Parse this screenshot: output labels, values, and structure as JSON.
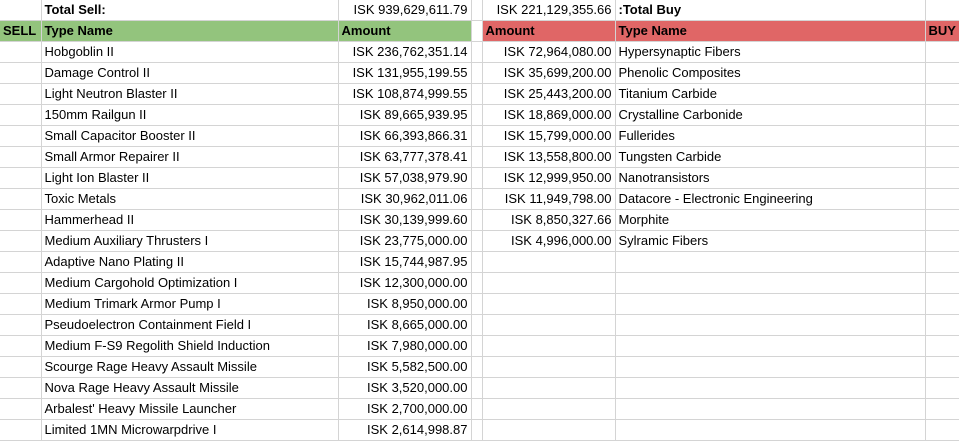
{
  "summary": {
    "total_sell_label": "Total Sell:",
    "total_sell_value": "ISK 939,629,611.79",
    "total_buy_value": "ISK 221,129,355.66",
    "total_buy_label": ":Total Buy"
  },
  "sell": {
    "tag": "SELL",
    "header_type": "Type Name",
    "header_amount": "Amount",
    "rows": [
      {
        "name": "Hobgoblin II",
        "amount": "ISK 236,762,351.14"
      },
      {
        "name": "Damage Control II",
        "amount": "ISK 131,955,199.55"
      },
      {
        "name": "Light Neutron Blaster II",
        "amount": "ISK 108,874,999.55"
      },
      {
        "name": "150mm Railgun II",
        "amount": "ISK 89,665,939.95"
      },
      {
        "name": "Small Capacitor Booster II",
        "amount": "ISK 66,393,866.31"
      },
      {
        "name": "Small Armor Repairer II",
        "amount": "ISK 63,777,378.41"
      },
      {
        "name": "Light Ion Blaster II",
        "amount": "ISK 57,038,979.90"
      },
      {
        "name": "Toxic Metals",
        "amount": "ISK 30,962,011.06"
      },
      {
        "name": "Hammerhead II",
        "amount": "ISK 30,139,999.60"
      },
      {
        "name": "Medium Auxiliary Thrusters I",
        "amount": "ISK 23,775,000.00"
      },
      {
        "name": "Adaptive Nano Plating II",
        "amount": "ISK 15,744,987.95"
      },
      {
        "name": "Medium Cargohold Optimization I",
        "amount": "ISK 12,300,000.00"
      },
      {
        "name": "Medium Trimark Armor Pump I",
        "amount": "ISK 8,950,000.00"
      },
      {
        "name": "Pseudoelectron Containment Field I",
        "amount": "ISK 8,665,000.00"
      },
      {
        "name": "Medium F-S9 Regolith Shield Induction",
        "amount": "ISK 7,980,000.00"
      },
      {
        "name": "Scourge Rage Heavy Assault Missile",
        "amount": "ISK 5,582,500.00"
      },
      {
        "name": "Nova Rage Heavy Assault Missile",
        "amount": "ISK 3,520,000.00"
      },
      {
        "name": "Arbalest' Heavy Missile Launcher",
        "amount": "ISK 2,700,000.00"
      },
      {
        "name": "Limited 1MN Microwarpdrive I",
        "amount": "ISK 2,614,998.87"
      }
    ]
  },
  "buy": {
    "tag": "BUY",
    "header_type": "Type Name",
    "header_amount": "Amount",
    "rows": [
      {
        "amount": "ISK 72,964,080.00",
        "name": "Hypersynaptic Fibers"
      },
      {
        "amount": "ISK 35,699,200.00",
        "name": "Phenolic Composites"
      },
      {
        "amount": "ISK 25,443,200.00",
        "name": "Titanium Carbide"
      },
      {
        "amount": "ISK 18,869,000.00",
        "name": "Crystalline Carbonide"
      },
      {
        "amount": "ISK 15,799,000.00",
        "name": "Fullerides"
      },
      {
        "amount": "ISK 13,558,800.00",
        "name": "Tungsten Carbide"
      },
      {
        "amount": "ISK 12,999,950.00",
        "name": "Nanotransistors"
      },
      {
        "amount": "ISK 11,949,798.00",
        "name": "Datacore - Electronic Engineering"
      },
      {
        "amount": "ISK 8,850,327.66",
        "name": "Morphite"
      },
      {
        "amount": "ISK 4,996,000.00",
        "name": "Sylramic Fibers"
      }
    ]
  }
}
